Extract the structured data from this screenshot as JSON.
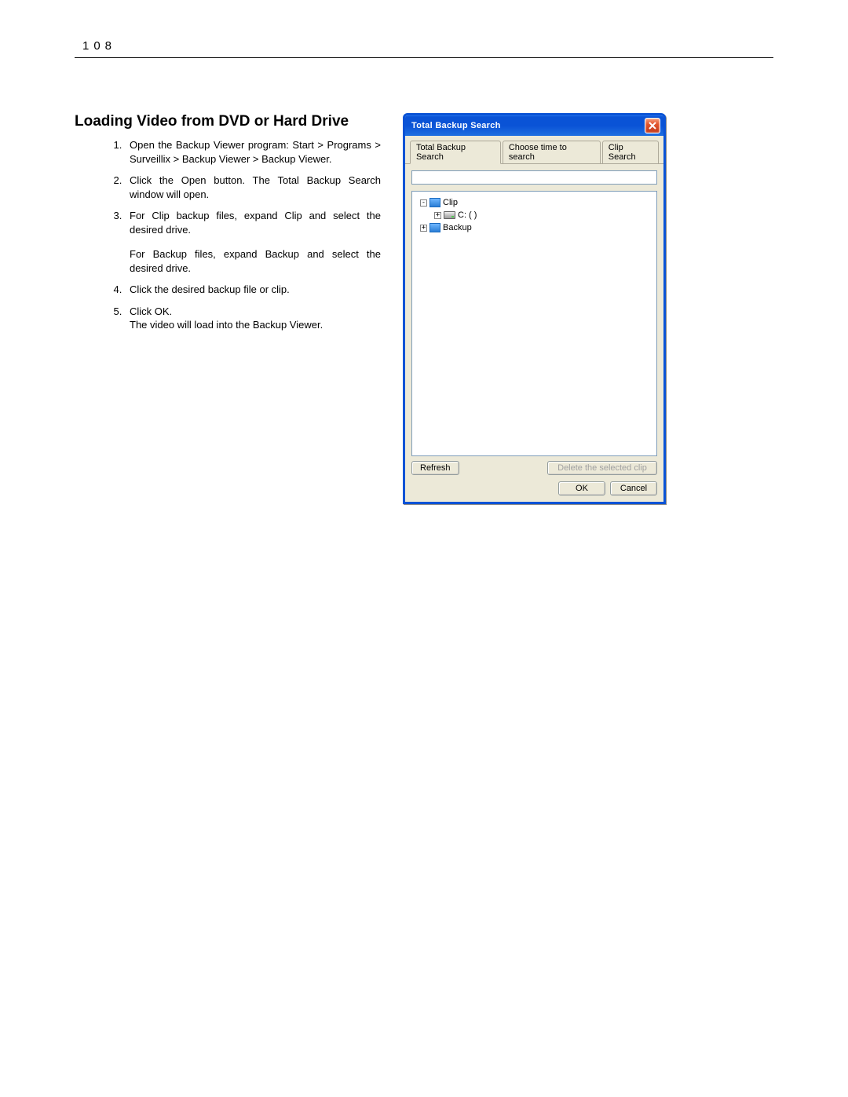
{
  "page_number": "108",
  "section_title": "Loading Video from DVD or Hard Drive",
  "steps": [
    {
      "n": "1",
      "text": "Open the Backup Viewer program: Start > Programs > Surveillix > Backup Viewer > Backup Viewer."
    },
    {
      "n": "2",
      "text": "Click the Open button. The Total Backup Search window will open."
    },
    {
      "n": "3",
      "text": "For Clip backup files, expand Clip and select the desired drive.",
      "sub": "For Backup files, expand Backup and select the desired drive."
    },
    {
      "n": "4",
      "text": "Click the desired backup file or clip."
    },
    {
      "n": "5",
      "text": "Click OK.",
      "sub": "The video will load into the Backup Viewer."
    }
  ],
  "dialog": {
    "title": "Total Backup Search",
    "close_aria": "Close",
    "tabs": {
      "t1": "Total Backup Search",
      "t2": "Choose time to search",
      "t3": "Clip Search"
    },
    "tree": {
      "clip_label": "Clip",
      "drive_label": "C: ( )",
      "backup_label": "Backup"
    },
    "buttons": {
      "refresh": "Refresh",
      "delete": "Delete the selected clip",
      "ok": "OK",
      "cancel": "Cancel"
    }
  }
}
